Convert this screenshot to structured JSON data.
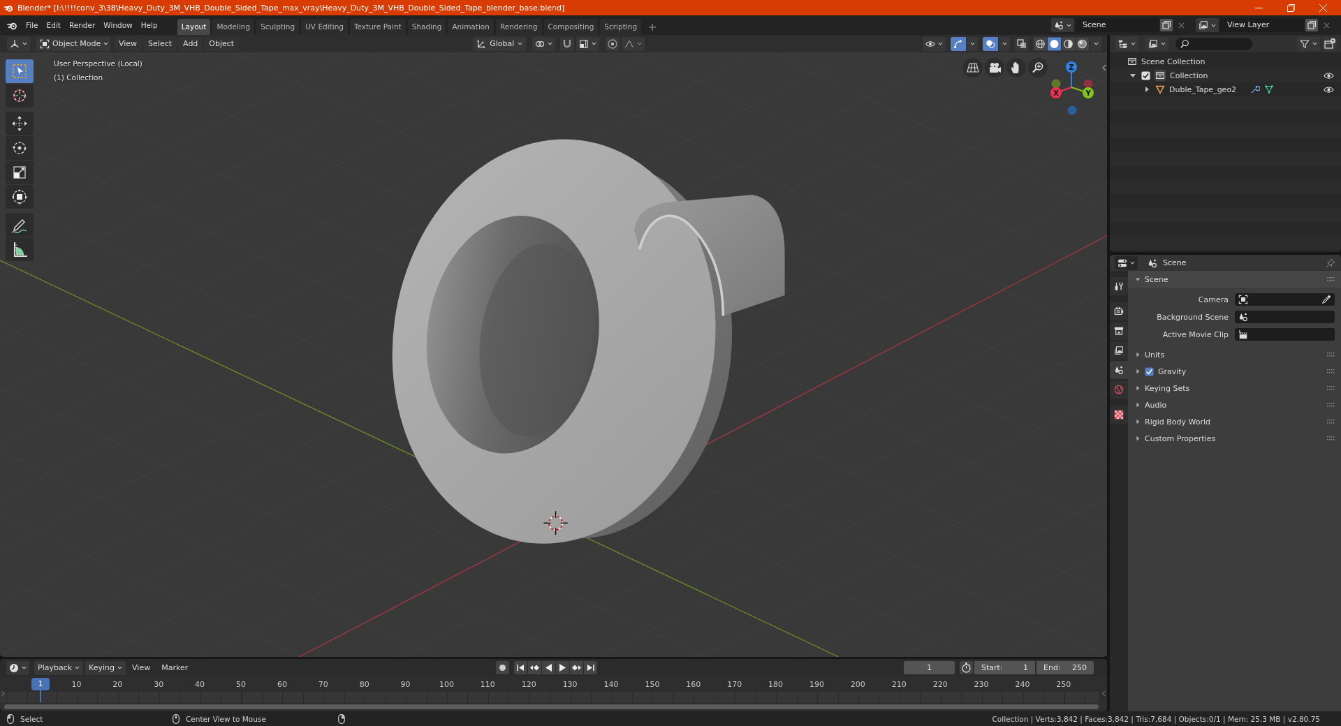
{
  "window": {
    "title": "Blender* [I:\\!!!!conv_3\\38\\Heavy_Duty_3M_VHB_Double_Sided_Tape_max_vray\\Heavy_Duty_3M_VHB_Double_Sided_Tape_blender_base.blend]"
  },
  "menu": [
    "File",
    "Edit",
    "Render",
    "Window",
    "Help"
  ],
  "workspaces": [
    {
      "label": "Layout",
      "selected": true
    },
    {
      "label": "Modeling",
      "selected": false
    },
    {
      "label": "Sculpting",
      "selected": false
    },
    {
      "label": "UV Editing",
      "selected": false
    },
    {
      "label": "Texture Paint",
      "selected": false
    },
    {
      "label": "Shading",
      "selected": false
    },
    {
      "label": "Animation",
      "selected": false
    },
    {
      "label": "Rendering",
      "selected": false
    },
    {
      "label": "Compositing",
      "selected": false
    },
    {
      "label": "Scripting",
      "selected": false
    }
  ],
  "scene_selector": {
    "value": "Scene"
  },
  "view_layer_selector": {
    "value": "View Layer"
  },
  "viewport": {
    "mode": "Object Mode",
    "menus": [
      "View",
      "Select",
      "Add",
      "Object"
    ],
    "orientation": "Global",
    "gizmos_on": true,
    "overlays_on": true,
    "xray_on": false,
    "shading": [
      {
        "kind": "wireframe",
        "selected": false
      },
      {
        "kind": "solid",
        "selected": true
      },
      {
        "kind": "material",
        "selected": false
      },
      {
        "kind": "rendered",
        "selected": false
      }
    ],
    "view_name": "User Perspective (Local)",
    "collection_label": "(1) Collection",
    "tool_groups": [
      {
        "tools": [
          {
            "kind": "select_box",
            "selected": true
          },
          {
            "kind": "cursor",
            "selected": false
          }
        ]
      },
      {
        "tools": [
          {
            "kind": "move",
            "selected": false
          },
          {
            "kind": "rotate",
            "selected": false
          },
          {
            "kind": "scale",
            "selected": false
          },
          {
            "kind": "transform",
            "selected": false
          }
        ]
      },
      {
        "tools": [
          {
            "kind": "annotate",
            "selected": false
          },
          {
            "kind": "measure",
            "selected": false
          }
        ]
      }
    ],
    "gizmo_axes": [
      {
        "label": "Z",
        "color": "#2f83e3"
      },
      {
        "label": "X",
        "color": "#ee3050"
      },
      {
        "label": "Y",
        "color": "#84c31c"
      }
    ]
  },
  "outliner": {
    "tree": [
      {
        "name": "Scene Collection",
        "kind": "scene_collection",
        "children": [
          {
            "name": "Collection",
            "kind": "collection",
            "expanded": true,
            "checked": true,
            "visible": true,
            "children": [
              {
                "name": "Duble_Tape_geo2",
                "kind": "mesh_object",
                "expanded": false,
                "visible": true
              }
            ]
          }
        ]
      }
    ]
  },
  "properties": {
    "context": "Scene",
    "tab_groups": [
      {
        "tabs": [
          {
            "kind": "tool",
            "selected": false
          }
        ]
      },
      {
        "tabs": [
          {
            "kind": "render",
            "selected": false
          },
          {
            "kind": "output",
            "selected": false
          },
          {
            "kind": "view_layer",
            "selected": false
          },
          {
            "kind": "scene",
            "selected": true
          },
          {
            "kind": "world",
            "selected": false
          }
        ]
      },
      {
        "tabs": [
          {
            "kind": "texture",
            "selected": false
          }
        ]
      }
    ],
    "panels": [
      {
        "title": "Scene",
        "kind": "plain",
        "expanded": true,
        "fields": [
          {
            "label": "Camera",
            "kind": "camera",
            "eyedropper": true
          },
          {
            "label": "Background Scene",
            "kind": "scene",
            "eyedropper": false
          },
          {
            "label": "Active Movie Clip",
            "kind": "movie_clip",
            "eyedropper": false
          }
        ]
      },
      {
        "title": "Units",
        "kind": "plain",
        "expanded": false
      },
      {
        "title": "Gravity",
        "kind": "toggle",
        "checked": true,
        "expanded": false
      },
      {
        "title": "Keying Sets",
        "kind": "plain",
        "expanded": false
      },
      {
        "title": "Audio",
        "kind": "plain",
        "expanded": false
      },
      {
        "title": "Rigid Body World",
        "kind": "plain",
        "expanded": false
      },
      {
        "title": "Custom Properties",
        "kind": "plain",
        "expanded": false
      }
    ]
  },
  "timeline": {
    "menus": [
      {
        "label": "Playback",
        "kind": "dropdown"
      },
      {
        "label": "Keying",
        "kind": "dropdown"
      },
      {
        "label": "View",
        "kind": "menu"
      },
      {
        "label": "Marker",
        "kind": "menu"
      }
    ],
    "auto_keying": false,
    "playhead": "1",
    "frame": "1",
    "start_label": "Start:",
    "start": "1",
    "end_label": "End:",
    "end": "250",
    "ruler": [
      "10",
      "20",
      "30",
      "40",
      "50",
      "60",
      "70",
      "80",
      "90",
      "100",
      "110",
      "120",
      "130",
      "140",
      "150",
      "160",
      "170",
      "180",
      "190",
      "200",
      "210",
      "220",
      "230",
      "240",
      "250"
    ]
  },
  "status_bar": {
    "hints": [
      {
        "kind": "left",
        "label": "Select"
      },
      {
        "kind": "middle",
        "label": "Center View to Mouse"
      },
      {
        "kind": "right"
      }
    ],
    "stats": "Collection | Verts:3,842 | Faces:3,842 | Tris:7,684 | Objects:0/1 | Mem: 25.3 MB | v2.80.75"
  }
}
